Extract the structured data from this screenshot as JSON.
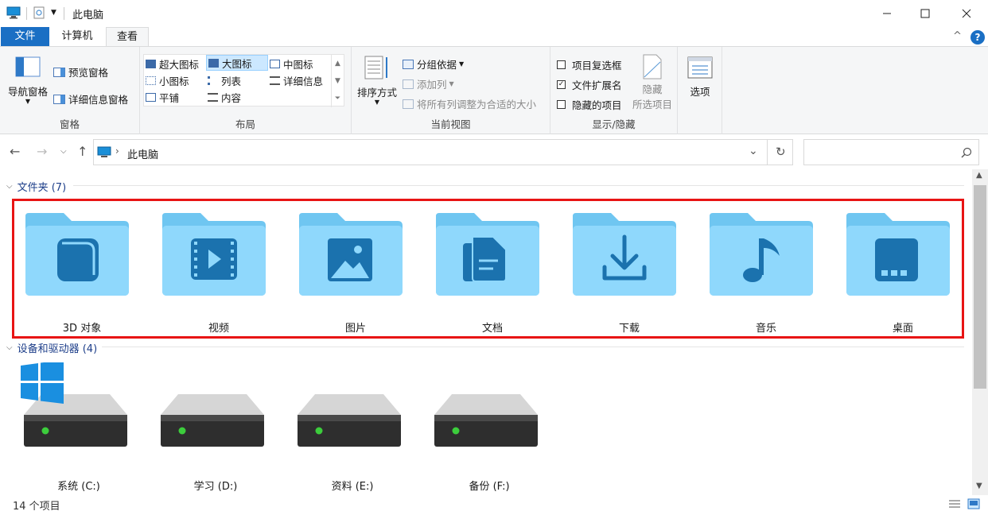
{
  "window": {
    "title": "此电脑"
  },
  "tabs": {
    "file": "文件",
    "computer": "计算机",
    "view": "查看"
  },
  "ribbon": {
    "panes": {
      "nav_pane": "导航窗格",
      "preview_pane": "预览窗格",
      "details_pane": "详细信息窗格",
      "label": "窗格"
    },
    "layout": {
      "items": [
        "超大图标",
        "大图标",
        "中图标",
        "小图标",
        "列表",
        "详细信息",
        "平铺",
        "内容"
      ],
      "selected": "大图标",
      "label": "布局"
    },
    "current_view": {
      "sort_by": "排序方式",
      "group_by": "分组依据",
      "add_column": "添加列",
      "fit_columns": "将所有列调整为合适的大小",
      "label": "当前视图"
    },
    "show_hide": {
      "item_checkboxes": "项目复选框",
      "file_extensions": "文件扩展名",
      "hidden_items": "隐藏的项目",
      "item_checkboxes_checked": false,
      "file_extensions_checked": true,
      "hidden_items_checked": false,
      "hide_selected_line1": "隐藏",
      "hide_selected_line2": "所选项目",
      "label": "显示/隐藏"
    },
    "options": "选项"
  },
  "address": {
    "path": "此电脑"
  },
  "folders": {
    "header": "文件夹 (7)",
    "items": [
      {
        "label": "3D 对象",
        "icon": "cube-icon"
      },
      {
        "label": "视频",
        "icon": "video-icon"
      },
      {
        "label": "图片",
        "icon": "picture-icon"
      },
      {
        "label": "文档",
        "icon": "document-icon"
      },
      {
        "label": "下载",
        "icon": "download-icon"
      },
      {
        "label": "音乐",
        "icon": "music-icon"
      },
      {
        "label": "桌面",
        "icon": "desktop-icon"
      }
    ]
  },
  "drives": {
    "header": "设备和驱动器 (4)",
    "items": [
      {
        "label": "系统 (C:)"
      },
      {
        "label": "学习 (D:)"
      },
      {
        "label": "资料 (E:)"
      },
      {
        "label": "备份 (F:)"
      }
    ]
  },
  "status": {
    "count": "14 个项目"
  },
  "colors": {
    "accent": "#1a6fc4",
    "folder": "#7fd3fb",
    "folder_icon": "#1a7db8",
    "highlight": "#e81414"
  }
}
